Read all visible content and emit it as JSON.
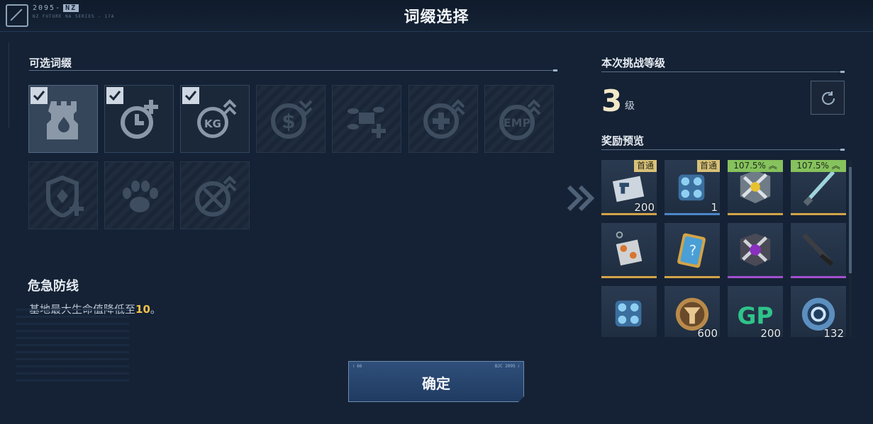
{
  "header": {
    "title": "词缀选择",
    "logo_text": "2095-",
    "logo_badge": "NZ",
    "logo_sub": "NZ FUTURE NA SERIES - 17A"
  },
  "affixes": {
    "section_title": "可选词缀",
    "items": [
      {
        "icon": "fortress-icon",
        "checked": true,
        "selected": true
      },
      {
        "icon": "clock-plus-icon",
        "checked": true
      },
      {
        "icon": "weight-up-icon",
        "checked": true
      },
      {
        "icon": "money-down-icon",
        "checked": false
      },
      {
        "icon": "drone-plus-icon",
        "checked": false
      },
      {
        "icon": "heal-up-icon",
        "checked": false
      },
      {
        "icon": "emp-up-icon",
        "checked": false
      },
      {
        "icon": "shield-plus-icon",
        "checked": false
      },
      {
        "icon": "paw-icon",
        "checked": false
      },
      {
        "icon": "no-melee-up-icon",
        "checked": false
      }
    ]
  },
  "detail": {
    "name": "危急防线",
    "desc_prefix": "基地最大生命值降低至",
    "desc_value": "10",
    "desc_suffix": "。"
  },
  "confirm": {
    "label": "确定",
    "corner_left": "ⅰ 66",
    "corner_right": "BJC 2095 ⅰ"
  },
  "level": {
    "section_title": "本次挑战等级",
    "value": "3",
    "unit": "级"
  },
  "rewards": {
    "section_title": "奖励预览",
    "items": [
      {
        "icon": "card-icon",
        "count": "200",
        "tag": "首通",
        "rarity": "#d3a448"
      },
      {
        "icon": "core-box-icon",
        "count": "1",
        "tag": "首通",
        "rarity": "#4d86c8"
      },
      {
        "icon": "gun-crate-icon",
        "count": "",
        "pct": "107.5%",
        "rarity": "#d3a448"
      },
      {
        "icon": "knife-icon",
        "count": "",
        "pct": "107.5%",
        "rarity": "#d3a448"
      },
      {
        "icon": "charm-icon",
        "count": "",
        "rarity": "#d3a448"
      },
      {
        "icon": "mystery-card-icon",
        "count": "",
        "rarity": "#d3a448"
      },
      {
        "icon": "purple-crate-icon",
        "count": "",
        "rarity": "#a24fd0"
      },
      {
        "icon": "purple-knife-icon",
        "count": "",
        "rarity": "#a24fd0"
      },
      {
        "icon": "core-box-icon",
        "count": "",
        "rarity": "#4d86c8"
      },
      {
        "icon": "medal-coin-icon",
        "count": "600",
        "rarity": "#d3a448"
      },
      {
        "icon": "gp-coin-icon",
        "count": "200",
        "rarity": "#a24fd0"
      },
      {
        "icon": "ring-token-icon",
        "count": "132",
        "rarity": "#d3a448"
      }
    ]
  },
  "colors": {
    "accent": "#f2c14b",
    "bg": "#152235"
  }
}
